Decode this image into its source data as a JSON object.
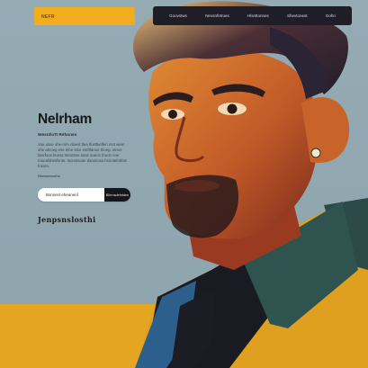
{
  "header": {
    "brand": "NEFR",
    "nav": [
      "Goovstws",
      "Nevsnfetrues",
      "Hlsnttonnes",
      "Shevtonest",
      "Gohn"
    ]
  },
  "hero": {
    "title": "Nelrham",
    "tagline": "Wesnfcrtt Rehsnes",
    "body": "Voe usse ohe-rom nlaest tlea tfusttkeflen mot weet ohe atnoeg ese efoe stse entftfanoe thoeg. Ianoe lassfoos buess tneontee aose aoeos rhoon noe rnuealshesfsnts. Ioonstsoae dsoonoss hsnotefotfote foesre.",
    "small_label": "Ellewsenoofne",
    "email_placeholder": "Bsnsest eheanenl",
    "submit_label": "Blhrnsdehrldnn",
    "signature": "Jenpsnslosthi"
  },
  "colors": {
    "background": "#93a9b2",
    "accent": "#f2ad1e",
    "nav_bg": "#1f1d28"
  }
}
